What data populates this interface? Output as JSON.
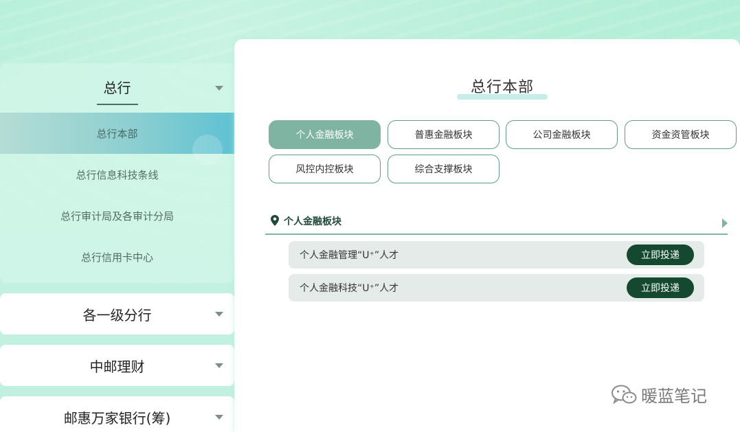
{
  "sidebar": {
    "open_group": {
      "title": "总行",
      "items": [
        {
          "label": "总行本部",
          "active": true
        },
        {
          "label": "总行信息科技条线",
          "active": false
        },
        {
          "label": "总行审计局及各审计分局",
          "active": false
        },
        {
          "label": "总行信用卡中心",
          "active": false
        }
      ]
    },
    "closed_groups": [
      {
        "label": "各一级分行"
      },
      {
        "label": "中邮理财"
      },
      {
        "label": "邮惠万家银行(筹)"
      }
    ]
  },
  "main": {
    "title": "总行本部",
    "tabs": [
      {
        "label": "个人金融板块",
        "active": true
      },
      {
        "label": "普惠金融板块",
        "active": false
      },
      {
        "label": "公司金融板块",
        "active": false
      },
      {
        "label": "资金资管板块",
        "active": false
      },
      {
        "label": "风控内控板块",
        "active": false
      },
      {
        "label": "综合支撑板块",
        "active": false
      }
    ],
    "section": {
      "label": "个人金融板块",
      "jobs": [
        {
          "name": "个人金融管理“U⁺”人才",
          "button": "立即投递"
        },
        {
          "name": "个人金融科技“U⁺”人才",
          "button": "立即投递"
        }
      ]
    }
  },
  "watermark": {
    "text": "暖蓝笔记"
  },
  "colors": {
    "accent": "#7fb3a2",
    "button_dark": "#15492f",
    "active_gradient_end": "#5fc2d2",
    "background": "#c0f0df"
  }
}
